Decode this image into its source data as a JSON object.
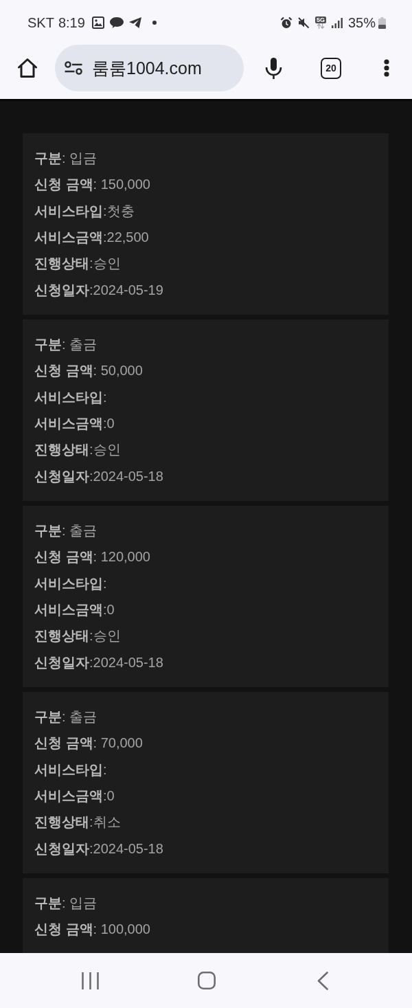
{
  "status_bar": {
    "carrier": "SKT",
    "time": "8:19",
    "network": "5G",
    "battery": "35%"
  },
  "toolbar": {
    "url": "룸룸1004.com",
    "tab_count": "20"
  },
  "records": [
    {
      "lines": [
        "**구분**: 입금",
        "**신청 금액**: 150,000",
        "**서비스타입**:첫충",
        "**서비스금액**:22,500",
        "**진행상태**:승인",
        "**신청일자**:2024-05-19"
      ]
    },
    {
      "lines": [
        "**구분**: 출금",
        "**신청 금액**: 50,000",
        "**서비스타입**:",
        "**서비스금액**:0",
        "**진행상태**:승인",
        "**신청일자**:2024-05-18"
      ]
    },
    {
      "lines": [
        "**구분**: 출금",
        "**신청 금액**: 120,000",
        "**서비스타입**:",
        "**서비스금액**:0",
        "**진행상태**:승인",
        "**신청일자**:2024-05-18"
      ]
    },
    {
      "lines": [
        "**구분**: 출금",
        "**신청 금액**: 70,000",
        "**서비스타입**:",
        "**서비스금액**:0",
        "**진행상태**:취소",
        "**신청일자**:2024-05-18"
      ]
    },
    {
      "lines": [
        "**구분**: 입금",
        "**신청 금액**: 100,000"
      ]
    }
  ]
}
